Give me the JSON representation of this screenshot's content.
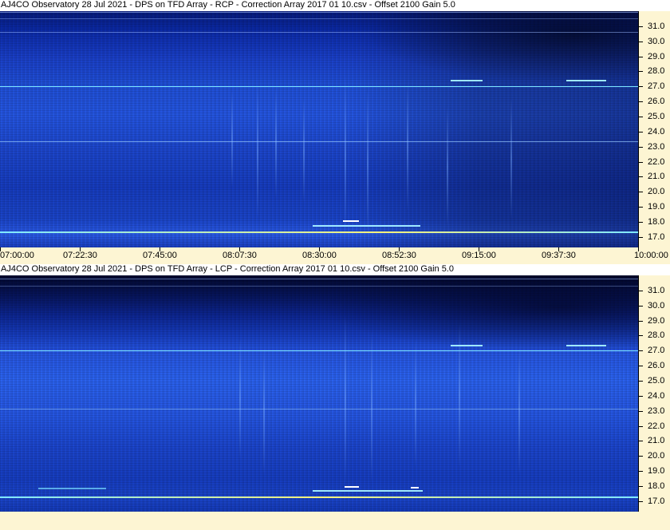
{
  "colors": {
    "background": "#fdf5d3",
    "spectrogram_dark": "#000a3c",
    "spectrogram_mid": "#1a3fc4",
    "spectrogram_bright": "#2a62ee",
    "line_cyan": "#7fe8ff",
    "line_yellow": "#f5f07a"
  },
  "chart_data": [
    {
      "type": "heatmap",
      "title": "AJ4CO Observatory 28 Jul 2021  -  DPS on TFD Array  -  RCP  -  Correction Array 2017 01 10.csv  -  Offset 2100  Gain 5.0",
      "xlabel": "",
      "ylabel": "",
      "x_range": [
        "07:00:00",
        "10:00:00"
      ],
      "x_ticks": [
        "07:00:00",
        "07:22:30",
        "07:45:00",
        "08:07:30",
        "08:30:00",
        "08:52:30",
        "09:15:00",
        "09:37:30",
        "10:00:00"
      ],
      "y_range": [
        16.3,
        32.0
      ],
      "y_ticks": [
        31.0,
        30.0,
        29.0,
        28.0,
        27.0,
        26.0,
        25.0,
        24.0,
        23.0,
        22.0,
        21.0,
        20.0,
        19.0,
        18.0,
        17.0
      ],
      "y_tick_labels": [
        "31.0",
        "30.0",
        "29.0",
        "28.0",
        "27.0",
        "26.0",
        "25.0",
        "24.0",
        "23.0",
        "22.0",
        "21.0",
        "20.0",
        "19.0",
        "18.0",
        "17.0"
      ],
      "narrowband_lines_mhz": [
        17.2,
        26.9,
        23.3
      ],
      "grid": false
    },
    {
      "type": "heatmap",
      "title": "AJ4CO Observatory 28 Jul 2021  -  DPS on TFD Array  -  LCP  -  Correction Array 2017 01 10.csv  -  Offset 2100  Gain 5.0",
      "xlabel": "",
      "ylabel": "",
      "x_range": [
        "07:00:00",
        "10:00:00"
      ],
      "x_ticks": [],
      "y_range": [
        16.3,
        32.0
      ],
      "y_ticks": [
        31.0,
        30.0,
        29.0,
        28.0,
        27.0,
        26.0,
        25.0,
        24.0,
        23.0,
        22.0,
        21.0,
        20.0,
        19.0,
        18.0,
        17.0
      ],
      "y_tick_labels": [
        "31.0",
        "30.0",
        "29.0",
        "28.0",
        "27.0",
        "26.0",
        "25.0",
        "24.0",
        "23.0",
        "22.0",
        "21.0",
        "20.0",
        "19.0",
        "18.0",
        "17.0"
      ],
      "narrowband_lines_mhz": [
        17.2,
        26.9,
        23.0
      ],
      "grid": false
    }
  ]
}
